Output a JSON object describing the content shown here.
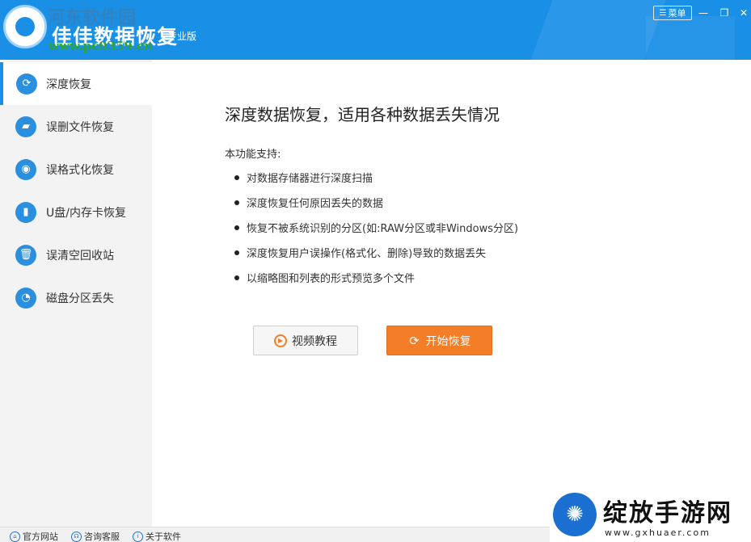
{
  "window": {
    "title": "佳佳数据恢复",
    "edition": "专业版",
    "watermark_top": "河东软件园",
    "watermark_url": "www.pc0359.cn",
    "menu_label": "菜单",
    "accent_color": "#1a8fe6"
  },
  "sidebar": {
    "items": [
      {
        "label": "深度恢复",
        "icon": "refresh-icon",
        "active": true
      },
      {
        "label": "误删文件恢复",
        "icon": "folder-icon",
        "active": false
      },
      {
        "label": "误格式化恢复",
        "icon": "disk-icon",
        "active": false
      },
      {
        "label": "U盘/内存卡恢复",
        "icon": "usb-icon",
        "active": false
      },
      {
        "label": "误清空回收站",
        "icon": "trash-icon",
        "active": false
      },
      {
        "label": "磁盘分区丢失",
        "icon": "pie-icon",
        "active": false
      }
    ]
  },
  "main": {
    "headline": "深度数据恢复，适用各种数据丢失情况",
    "support_label": "本功能支持:",
    "features": [
      "对数据存储器进行深度扫描",
      "深度恢复任何原因丢失的数据",
      "恢复不被系统识别的分区(如:RAW分区或非Windows分区)",
      "深度恢复用户误操作(格式化、删除)导致的数据丢失",
      "以缩略图和列表的形式预览多个文件"
    ],
    "video_button": "视频教程",
    "start_button": "开始恢复",
    "start_color": "#f47d28"
  },
  "footer": {
    "links": [
      "官方网站",
      "咨询客服",
      "关于软件"
    ]
  },
  "watermark_bottom": {
    "text": "绽放手游网",
    "url": "www.gxhuaer.com"
  }
}
